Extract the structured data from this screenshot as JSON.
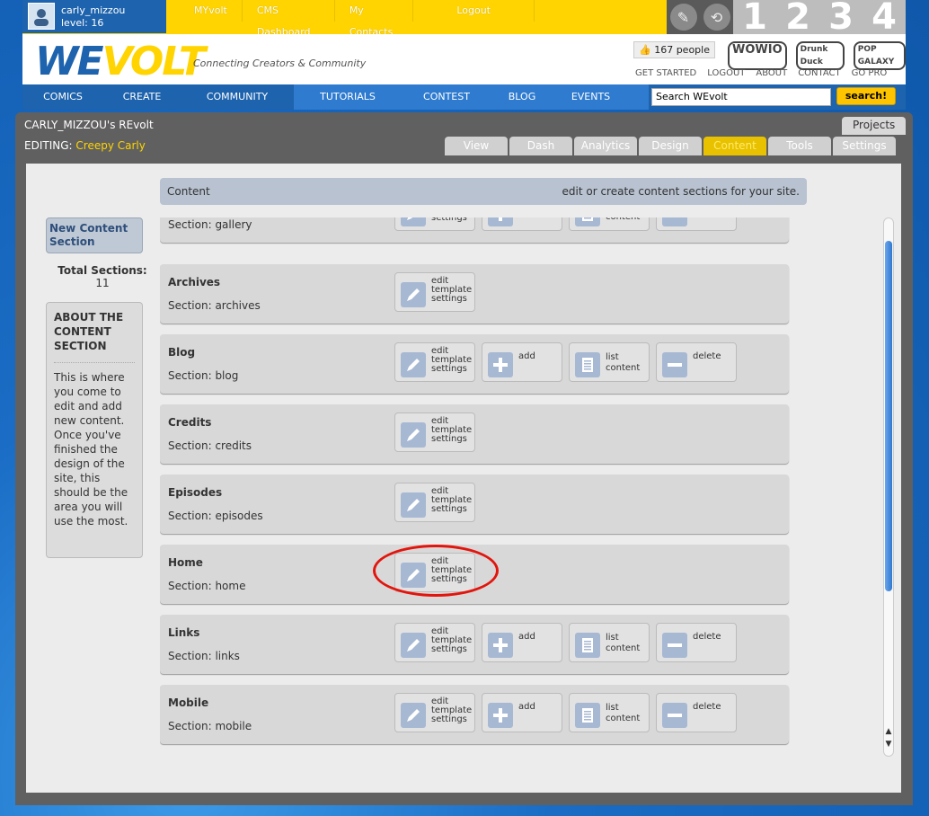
{
  "user": {
    "name": "carly_mizzou",
    "level": "level: 16"
  },
  "topnav": [
    "MYvolt",
    "CMS Dashboard",
    "My Contacts",
    "Logout"
  ],
  "level_numbers": [
    "1",
    "2",
    "3",
    "4"
  ],
  "brand": {
    "logo_a": "WE",
    "logo_b": "VOLT",
    "tagline": "Connecting Creators & Community"
  },
  "likes": "167 people",
  "brands": [
    "WOWIO",
    "Drunk Duck",
    "POP GALAXY"
  ],
  "header_links": [
    "GET STARTED",
    "LOGOUT",
    "ABOUT",
    "CONTACT",
    "GO PRO"
  ],
  "mainnav": [
    "COMICS",
    "CREATE",
    "COMMUNITY",
    "TUTORIALS",
    "CONTEST",
    "BLOG",
    "EVENTS"
  ],
  "search": {
    "value": "Search WEvolt",
    "button": "search!"
  },
  "panel": {
    "title": "CARLY_MIZZOU's REvolt",
    "projects": "Projects",
    "editing_label": "EDITING:",
    "editing_name": "Creepy Carly",
    "tabs": [
      "View",
      "Dash",
      "Analytics",
      "Design",
      "Content",
      "Tools",
      "Settings"
    ]
  },
  "content_header": {
    "left": "Content",
    "right": "edit or create content sections for your site."
  },
  "sidebar": {
    "new_button": "New Content Section",
    "total_label": "Total Sections:",
    "total_count": "11",
    "about_title": "ABOUT THE CONTENT SECTION",
    "about_text": "This is where you come to edit and add new content. Once you've finished the design of the site, this should be the area you will use the most."
  },
  "actions": {
    "edit": "edit template settings",
    "add": "add",
    "list": "list content",
    "delete": "delete"
  },
  "sections": [
    {
      "name": "",
      "section": "Section: gallery",
      "full": true
    },
    {
      "name": "Archives",
      "section": "Section: archives",
      "full": false
    },
    {
      "name": "Blog",
      "section": "Section: blog",
      "full": true
    },
    {
      "name": "Credits",
      "section": "Section: credits",
      "full": false
    },
    {
      "name": "Episodes",
      "section": "Section: episodes",
      "full": false
    },
    {
      "name": "Home",
      "section": "Section: home",
      "full": false
    },
    {
      "name": "Links",
      "section": "Section: links",
      "full": true
    },
    {
      "name": "Mobile",
      "section": "Section: mobile",
      "full": true
    }
  ]
}
